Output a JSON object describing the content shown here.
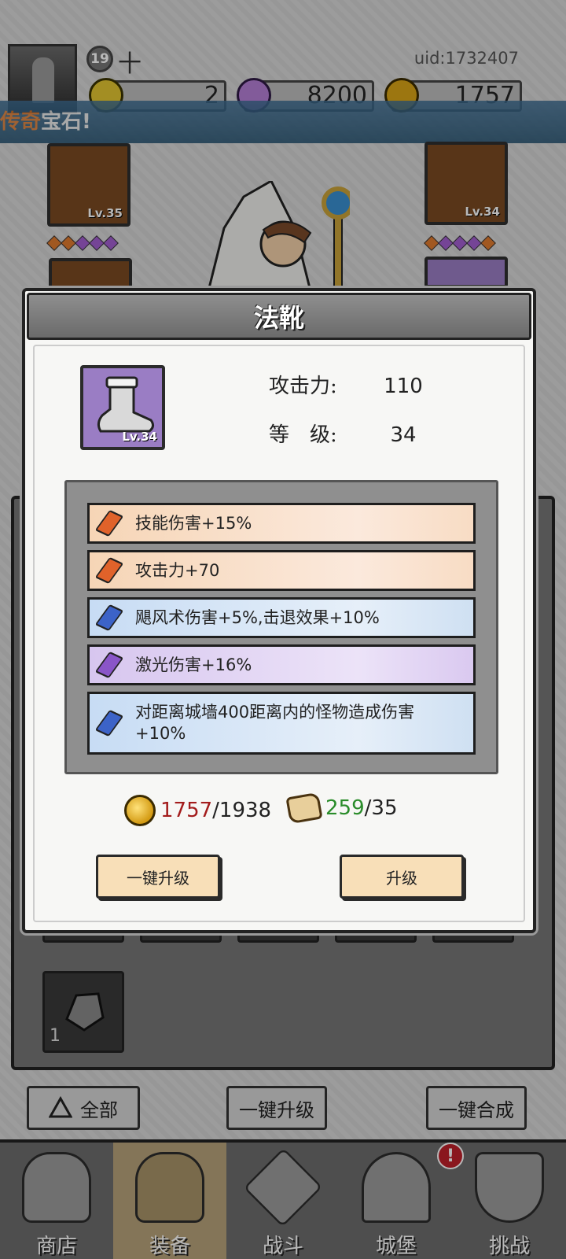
{
  "player": {
    "level": "19",
    "name": "十",
    "uid": "uid:1732407"
  },
  "currencies": [
    {
      "name": "gem-yellow",
      "value": "2",
      "color": "#e2c531"
    },
    {
      "name": "diamond",
      "value": "8200",
      "color": "#b57fd6"
    },
    {
      "name": "gold-coin",
      "value": "1757",
      "color": "#d9a417"
    }
  ],
  "banner": {
    "highlight": "传奇",
    "text": "宝石!"
  },
  "equipment_slots": [
    {
      "level": "Lv.35"
    },
    {
      "level": "Lv.34"
    }
  ],
  "inventory": {
    "item_count": "1"
  },
  "bottom_actions": {
    "filter_label": "全部",
    "upgrade_all_label": "一键升级",
    "merge_all_label": "一键合成"
  },
  "nav": [
    {
      "label": "商店",
      "active": false
    },
    {
      "label": "装备",
      "active": true
    },
    {
      "label": "战斗",
      "active": false
    },
    {
      "label": "城堡",
      "active": false
    },
    {
      "label": "挑战",
      "active": false
    }
  ],
  "nav_alert": "!",
  "modal": {
    "title": "法靴",
    "item_level": "Lv.34",
    "stats": [
      {
        "label": "攻击力:",
        "value": "110"
      },
      {
        "label": "等　级:",
        "value": "34"
      }
    ],
    "affixes": [
      {
        "text": "技能伤害+15%",
        "gem": "orange"
      },
      {
        "text": "攻击力+70",
        "gem": "orange"
      },
      {
        "text": "飓风术伤害+5%,击退效果+10%",
        "gem": "blue"
      },
      {
        "text": "激光伤害+16%",
        "gem": "purple"
      },
      {
        "text": "对距离城墙400距离内的怪物造成伤害+10%",
        "gem": "blue"
      }
    ],
    "gem_colors": {
      "orange": "#e0622a",
      "blue": "#3c63c8",
      "purple": "#8a55c8"
    },
    "cost": {
      "gold_have": "1757",
      "gold_need": "/1938",
      "scroll_have": "259",
      "scroll_need": "/35"
    },
    "buttons": {
      "upgrade_all": "一键升级",
      "upgrade": "升级"
    }
  }
}
